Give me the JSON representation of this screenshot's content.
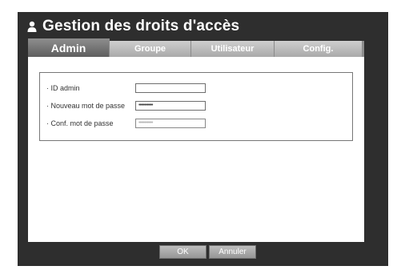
{
  "window": {
    "title": "Gestion des droits d'accès",
    "icon": "user-icon"
  },
  "tabs": [
    {
      "label": "Admin",
      "active": true
    },
    {
      "label": "Groupe",
      "active": false
    },
    {
      "label": "Utilisateur",
      "active": false
    },
    {
      "label": "Config.",
      "active": false
    }
  ],
  "form": {
    "id_label": "· ID  admin",
    "id_value": "",
    "new_password_label": "· Nouveau mot de passe",
    "new_password_value": "••••••••••••",
    "confirm_password_label": "· Conf. mot de passe",
    "confirm_password_value": "••••••••••••"
  },
  "buttons": {
    "ok": "OK",
    "cancel": "Annuler"
  },
  "colors": {
    "frame": "#2e2e2e",
    "active_tab": "#7a7a7a",
    "inactive_tab": "#bcbcbc"
  }
}
